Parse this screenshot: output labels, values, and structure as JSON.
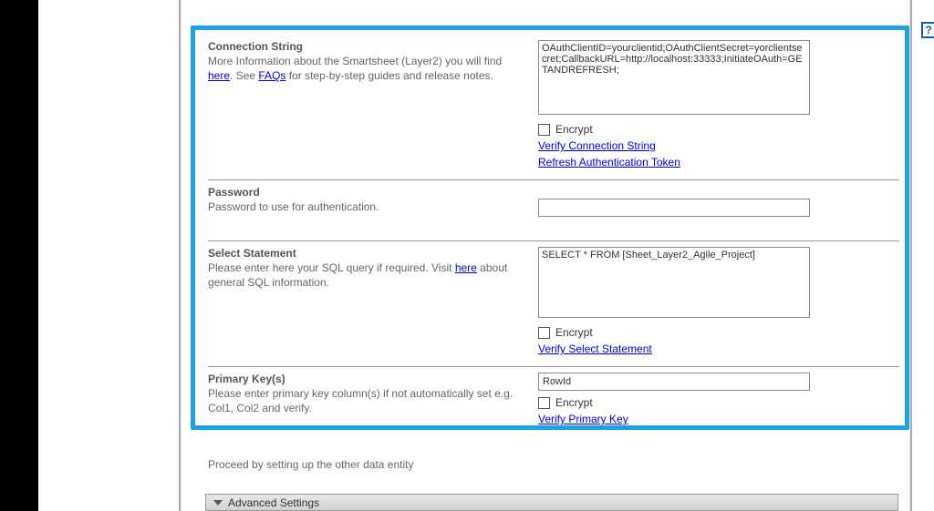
{
  "connectionString": {
    "title": "Connection String",
    "descA": "More Information about the Smartsheet (Layer2) you will find ",
    "linkHere": "here",
    "descB": ". See ",
    "linkFaq": "FAQs",
    "descC": " for step-by-step guides and release notes.",
    "value": "OAuthClientID=yourclientid;OAuthClientSecret=yorclientsecret;CallbackURL=http://localhost:33333;InitiateOAuth=GETANDREFRESH;",
    "encryptLabel": "Encrypt",
    "verifyLink": "Verify Connection String",
    "refreshLink": "Refresh Authentication Token"
  },
  "password": {
    "title": "Password",
    "desc": "Password to use for authentication.",
    "value": ""
  },
  "selectStatement": {
    "title": "Select Statement",
    "descA": "Please enter here your SQL query if required. Visit ",
    "linkHere": "here",
    "descB": " about general SQL information.",
    "value": "SELECT * FROM [Sheet_Layer2_Agile_Project]",
    "encryptLabel": "Encrypt",
    "verifyLink": "Verify Select Statement"
  },
  "primaryKey": {
    "title": "Primary Key(s)",
    "desc": "Please enter primary key column(s) if not automatically set e.g. Col1, Col2 and verify.",
    "value": "RowId",
    "encryptLabel": "Encrypt",
    "verifyLink": "Verify Primary Key"
  },
  "proceedText": "Proceed by setting up the other data entity",
  "advancedSettings": "Advanced Settings",
  "helpGlyph": "?"
}
